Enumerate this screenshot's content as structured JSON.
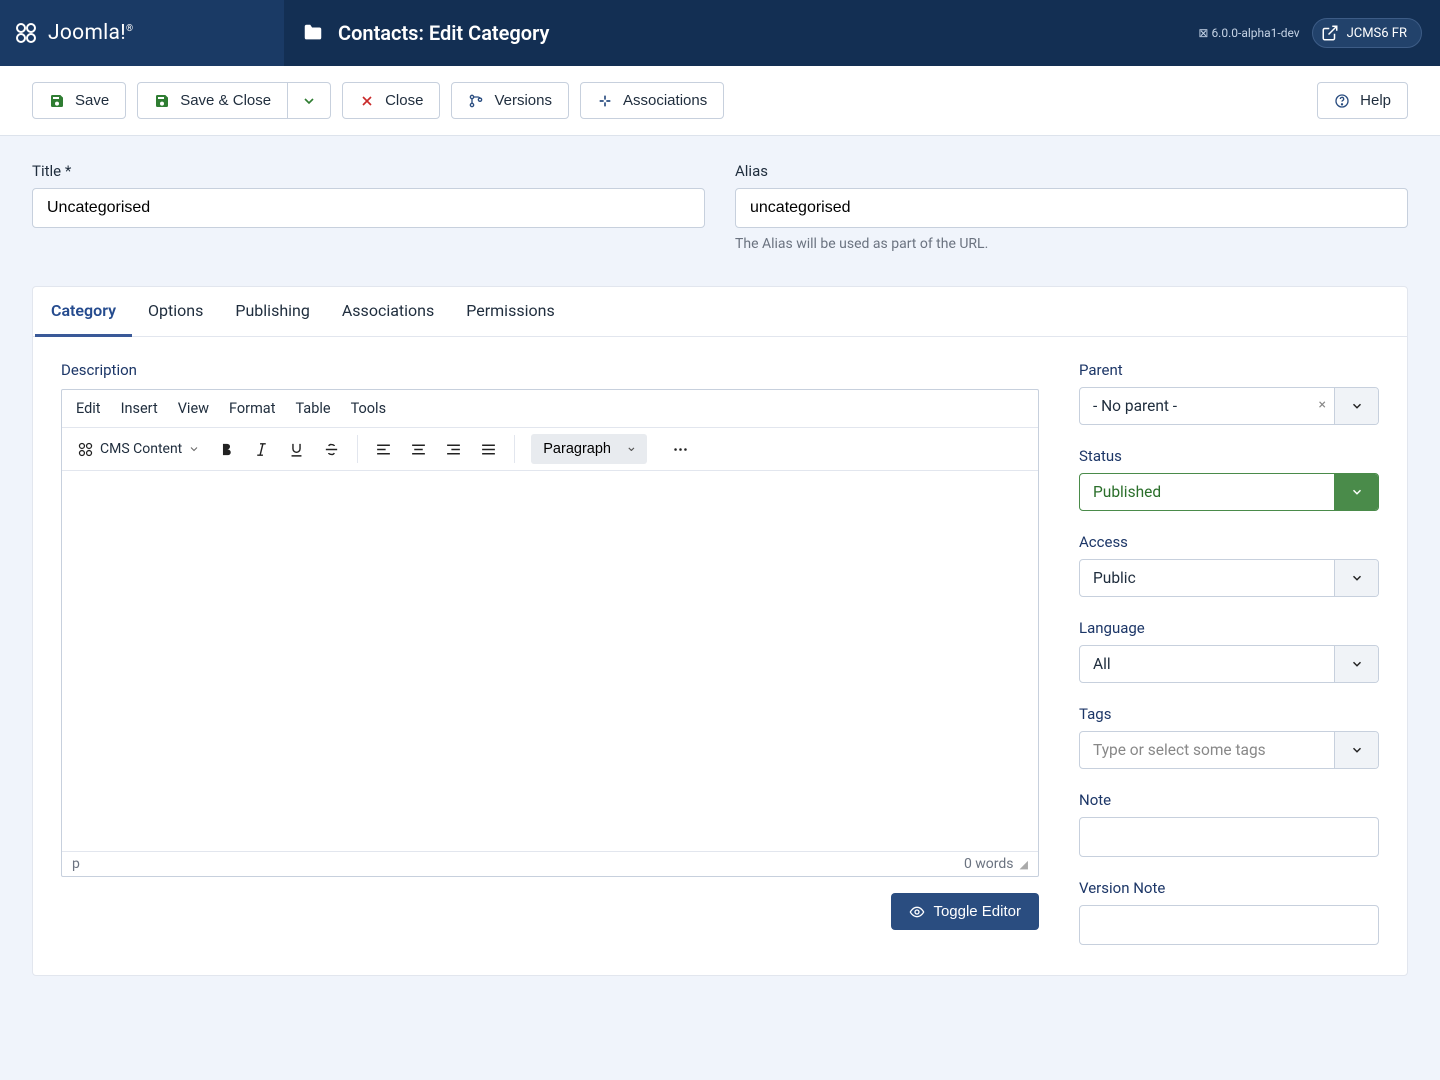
{
  "brand": "Joomla!",
  "page_title": "Contacts: Edit Category",
  "header_version": "6.0.0-alpha1-dev",
  "header_badge": "JCMS6 FR",
  "toolbar": {
    "save": "Save",
    "save_close": "Save & Close",
    "close": "Close",
    "versions": "Versions",
    "associations": "Associations",
    "help": "Help"
  },
  "fields": {
    "title_label": "Title *",
    "title_value": "Uncategorised",
    "alias_label": "Alias",
    "alias_value": "uncategorised",
    "alias_hint": "The Alias will be used as part of the URL."
  },
  "tabs": [
    "Category",
    "Options",
    "Publishing",
    "Associations",
    "Permissions"
  ],
  "desc_label": "Description",
  "editor": {
    "menus": [
      "Edit",
      "Insert",
      "View",
      "Format",
      "Table",
      "Tools"
    ],
    "cms": "CMS Content",
    "block": "Paragraph",
    "path": "p",
    "words": "0 words"
  },
  "toggle_editor": "Toggle Editor",
  "side": {
    "parent": {
      "label": "Parent",
      "value": "- No parent -"
    },
    "status": {
      "label": "Status",
      "value": "Published"
    },
    "access": {
      "label": "Access",
      "value": "Public"
    },
    "language": {
      "label": "Language",
      "value": "All"
    },
    "tags": {
      "label": "Tags",
      "placeholder": "Type or select some tags"
    },
    "note": {
      "label": "Note"
    },
    "version_note": {
      "label": "Version Note"
    }
  }
}
